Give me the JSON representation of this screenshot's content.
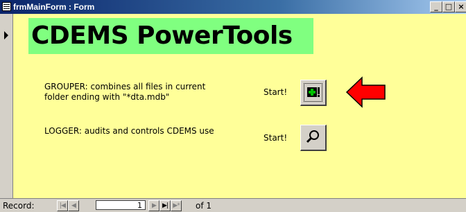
{
  "window": {
    "title": "frmMainForm : Form",
    "minimize_glyph": "_",
    "restore_glyph": "□",
    "close_glyph": "×"
  },
  "form": {
    "header_title": "CDEMS PowerTools",
    "grouper": {
      "description": "GROUPER: combines all files in current folder ending with \"*dta.mdb\"",
      "start_label": "Start!",
      "button_icon": "plus-exclamation-icon"
    },
    "logger": {
      "description": "LOGGER: audits and controls CDEMS use",
      "start_label": "Start!",
      "button_icon": "magnifier-icon"
    }
  },
  "navigation": {
    "record_label": "Record:",
    "current_record": "1",
    "of_label": "of",
    "total_records": "1",
    "first_glyph": "|◀",
    "prev_glyph": "◀",
    "next_glyph": "▶",
    "last_glyph": "▶|",
    "new_glyph": "▶*"
  },
  "colors": {
    "form_background": "#ffff99",
    "header_highlight": "#80ff80",
    "arrow_red": "#ff0000",
    "titlebar_start": "#0a246a"
  }
}
